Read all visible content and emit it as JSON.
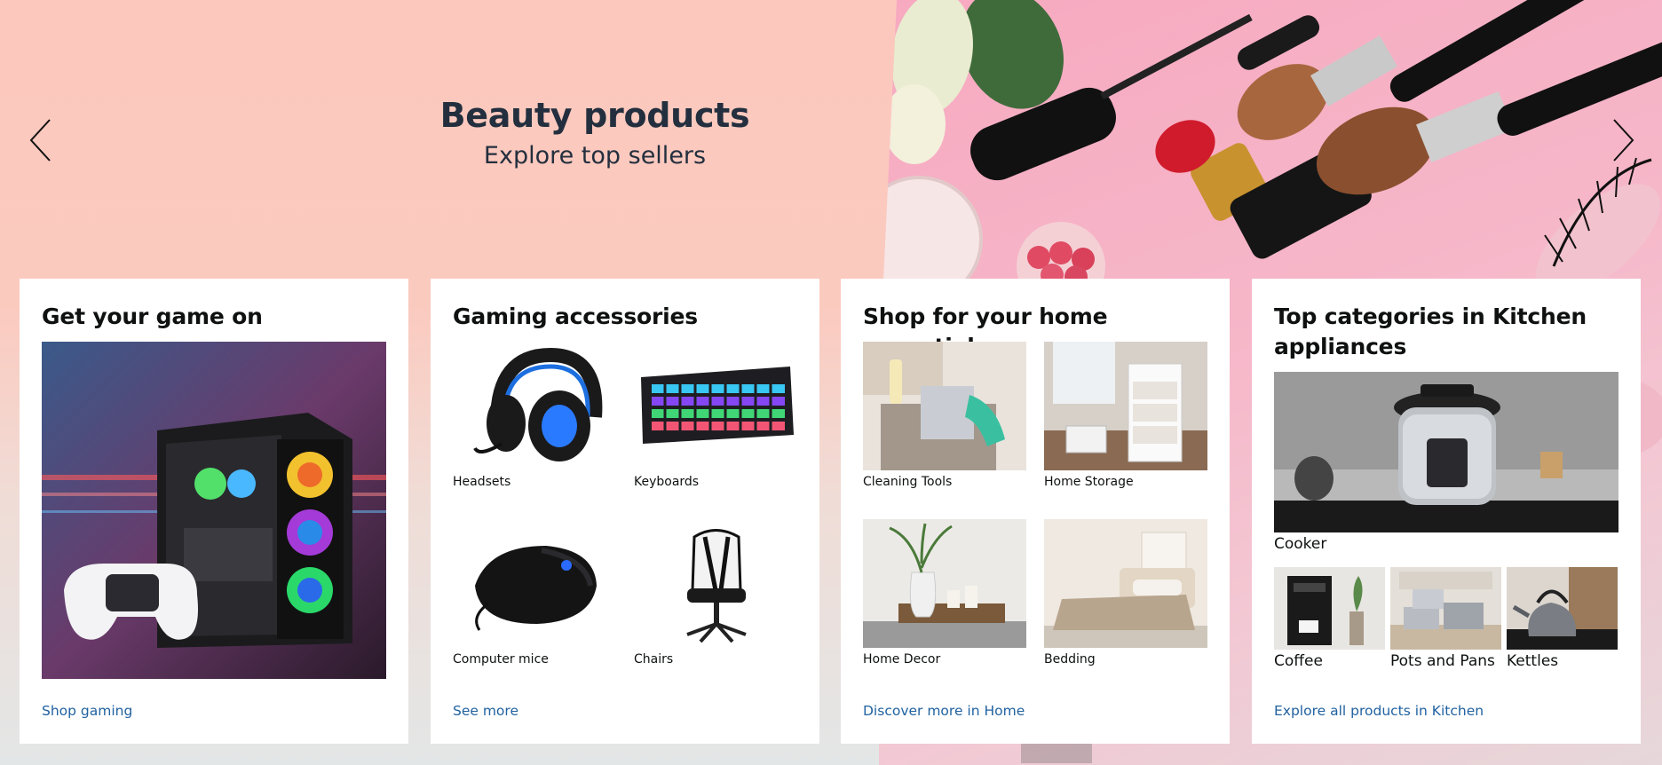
{
  "hero": {
    "title": "Beauty products",
    "subtitle": "Explore top sellers",
    "prev_icon": "chevron-left-icon",
    "next_icon": "chevron-right-icon"
  },
  "cards": {
    "gaming": {
      "title": "Get your game on",
      "link": "Shop gaming"
    },
    "accessories": {
      "title": "Gaming accessories",
      "items": [
        "Headsets",
        "Keyboards",
        "Computer mice",
        "Chairs"
      ],
      "link": "See more"
    },
    "home": {
      "title": "Shop for your home essentials",
      "items": [
        "Cleaning Tools",
        "Home Storage",
        "Home Decor",
        "Bedding"
      ],
      "link": "Discover more in Home"
    },
    "kitchen": {
      "title": "Top categories in Kitchen appliances",
      "main_item": "Cooker",
      "items": [
        "Coffee",
        "Pots and Pans",
        "Kettles"
      ],
      "link": "Explore all products in Kitchen"
    }
  },
  "colors": {
    "link": "#2162a1",
    "hero_bg": "#fcc8bd",
    "heading": "#232f3e"
  }
}
